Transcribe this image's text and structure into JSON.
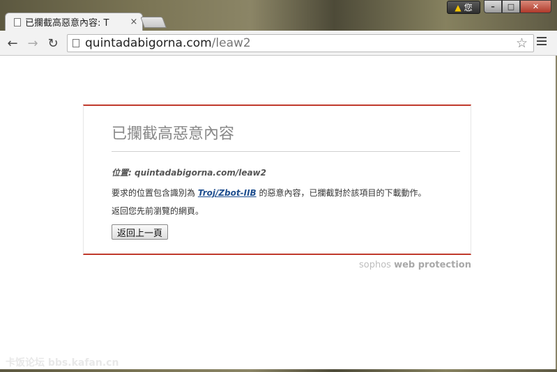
{
  "window": {
    "user_badge": "您",
    "minimize": "–",
    "maximize": "□",
    "close": "✕"
  },
  "tab": {
    "title": "已攔截高惡意內容: T",
    "close": "×"
  },
  "toolbar": {
    "back": "←",
    "forward": "→",
    "reload": "↻",
    "url_host": "quintadabigorna.com",
    "url_path": "/leaw2",
    "star": "☆"
  },
  "block_page": {
    "title": "已攔截高惡意內容",
    "location_label": "位置:",
    "location_value": "quintadabigorna.com/leaw2",
    "message_before": "要求的位置包含識別為 ",
    "threat_name": "Troj/Zbot-IIB",
    "message_after": " 的惡意內容，已攔截對於該項目的下載動作。",
    "back_text": "返回您先前瀏覽的網頁。",
    "back_button": "返回上一頁"
  },
  "footer": {
    "brand_light": "sophos ",
    "brand_bold": "web protection"
  },
  "watermark": "卡饭论坛 bbs.kafan.cn",
  "colors": {
    "accent_red": "#c0392b",
    "link_blue": "#1f4f8f"
  }
}
